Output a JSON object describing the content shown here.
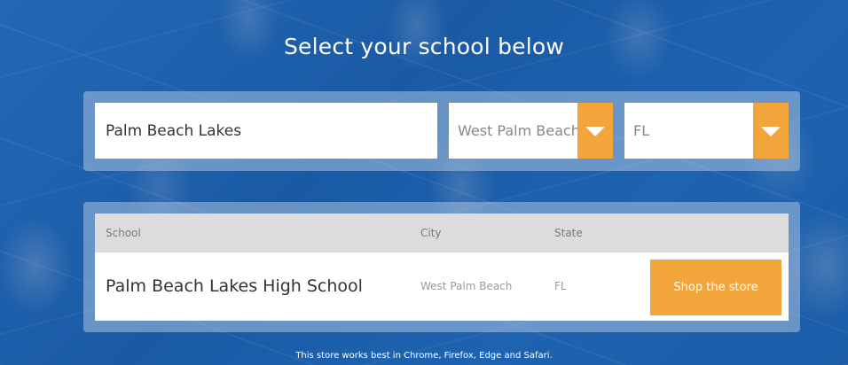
{
  "header": {
    "title": "Select your school below"
  },
  "search": {
    "school_value": "Palm Beach Lakes",
    "city_value": "West Palm Beach",
    "state_value": "FL"
  },
  "results": {
    "columns": [
      "School",
      "City",
      "State"
    ],
    "rows": [
      {
        "school": "Palm Beach Lakes High School",
        "city": "West Palm Beach",
        "state": "FL",
        "action_label": "Shop the store"
      }
    ]
  },
  "footer": {
    "note": "This store works best in Chrome, Firefox, Edge and Safari."
  },
  "colors": {
    "background": "#1d63b0",
    "accent": "#f2a53a",
    "header_row": "#dcdcdc"
  },
  "icons": {
    "dropdown": "chevron-down-icon"
  }
}
